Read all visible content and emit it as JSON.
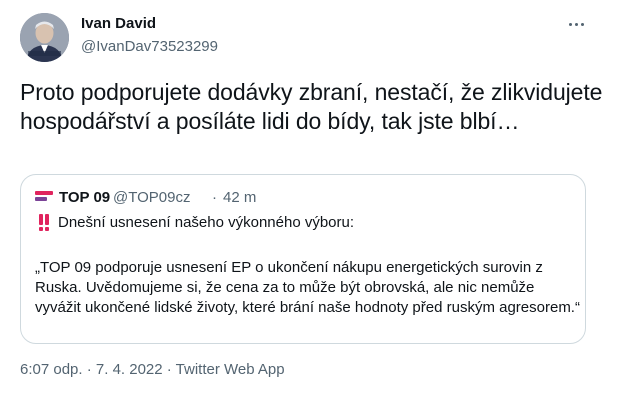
{
  "author": {
    "name": "Ivan David",
    "handle": "@IvanDav73523299"
  },
  "tweet": {
    "text": "Proto podporujete dodávky zbraní, nestačí, že zlikvidujete hospodářství a posíláte lidi do bídy, tak jste blbí…"
  },
  "quoted": {
    "name": "TOP 09",
    "handle": "@TOP09cz",
    "separator": "·",
    "time": "42 m",
    "first_line": "Dnešní usnesení našeho výkonného výboru:",
    "paragraph": "„TOP 09 podporuje usnesení EP o ukončení nákupu energetických surovin z Ruska. Uvědomujeme si, že cena za to může být obrovská, ale nic nemůže vyvážit ukončené lidské životy, které brání naše hodnoty před ruským agresorem.“",
    "logo_colors": [
      "#e0245e",
      "#7b4397"
    ]
  },
  "meta": {
    "timestamp": "6:07 odp. · 7. 4. 2022 · Twitter Web App"
  },
  "colors": {
    "text": "#0f1419",
    "secondary": "#536471",
    "border": "#cfd9de",
    "alert": "#e0245e"
  },
  "icons": {
    "more": "more-horizontal-icon",
    "alert": "double-exclamation-icon",
    "logo": "top09-logo-icon"
  }
}
